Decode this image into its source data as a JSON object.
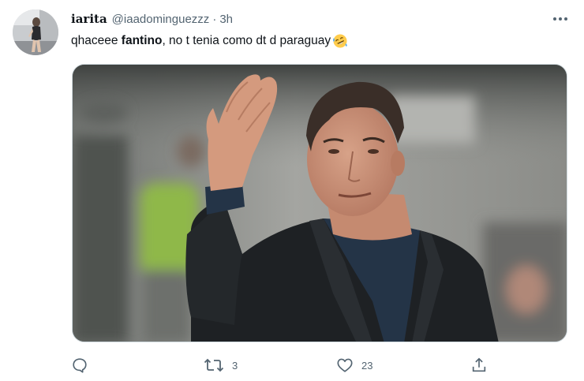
{
  "tweet": {
    "author": {
      "display_name": "iarita",
      "handle": "@iaadominguezzz",
      "time": "3h"
    },
    "text": {
      "prefix": "qhaceee ",
      "bold": "fantino",
      "suffix": ", no t tenia como dt d paraguay",
      "emoji": "rolling-on-floor-laughing-emoji"
    },
    "media": {
      "description_icon": "photo"
    },
    "actions": {
      "reply_count": "",
      "retweet_count": "3",
      "like_count": "23",
      "share_count": ""
    }
  },
  "colors": {
    "text_primary": "#0f1419",
    "text_secondary": "#536471",
    "border": "#cfd9de"
  }
}
